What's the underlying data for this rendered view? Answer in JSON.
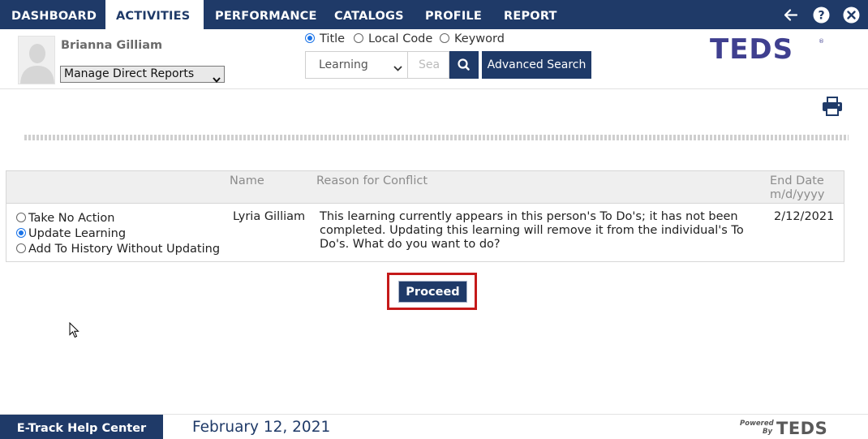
{
  "nav": {
    "items": [
      {
        "label": "DASHBOARD"
      },
      {
        "label": "ACTIVITIES"
      },
      {
        "label": "PERFORMANCE"
      },
      {
        "label": "CATALOGS"
      },
      {
        "label": "PROFILE"
      },
      {
        "label": "REPORT"
      }
    ],
    "active": "ACTIVITIES",
    "icons": [
      "back-arrow-icon",
      "help-icon",
      "close-icon"
    ]
  },
  "header": {
    "user_name": "Brianna Gilliam",
    "reports_select": "Manage Direct Reports",
    "search_modes": [
      {
        "label": "Title",
        "selected": true
      },
      {
        "label": "Local Code",
        "selected": false
      },
      {
        "label": "Keyword",
        "selected": false
      }
    ],
    "search_type": "Learning",
    "search_placeholder": "Sea",
    "advanced_search": "Advanced Search",
    "logo": "TEDS"
  },
  "conflict_table": {
    "columns": {
      "name": "Name",
      "reason": "Reason for Conflict",
      "end_date": "End Date",
      "end_date_format": "m/d/yyyy"
    },
    "actions": [
      {
        "label": "Take No Action",
        "selected": false
      },
      {
        "label": "Update Learning",
        "selected": true
      },
      {
        "label": "Add To History Without Updating",
        "selected": false
      }
    ],
    "row": {
      "name": "Lyria Gilliam",
      "reason": "This learning currently appears in this person's To Do's; it has not been completed. Updating this learning will remove it from the individual's To Do's. What do you want to do?",
      "end_date": "2/12/2021"
    }
  },
  "proceed_label": "Proceed",
  "footer": {
    "help_center": "E-Track Help Center",
    "date": "February 12, 2021",
    "powered_by": "Powered By",
    "powered_logo": "TEDS"
  },
  "colors": {
    "brand_navy": "#1f3a68",
    "highlight_red": "#c51a1a",
    "logo_purple": "#3f3f8f"
  }
}
